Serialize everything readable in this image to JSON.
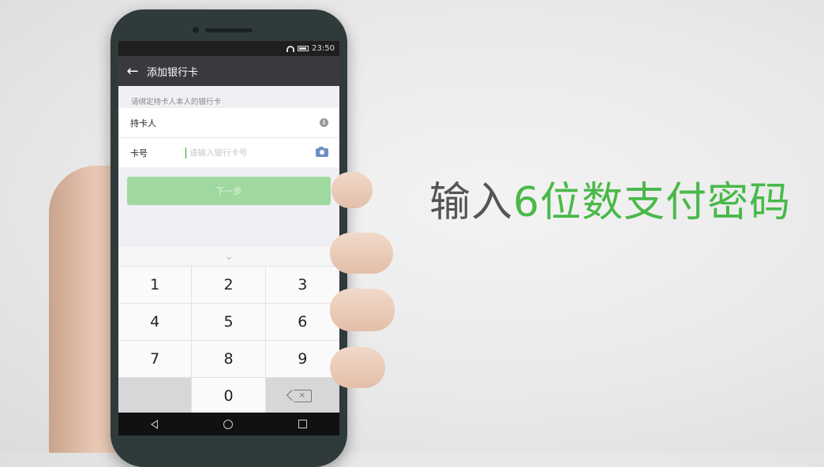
{
  "status_bar": {
    "time": "23:50"
  },
  "header": {
    "back_icon": "arrow-left-icon",
    "title": "添加银行卡"
  },
  "form": {
    "hint": "请绑定持卡人本人的银行卡",
    "cardholder_label": "持卡人",
    "cardholder_info_icon": "info-icon",
    "card_number_label": "卡号",
    "card_number_placeholder": "请输入银行卡号",
    "camera_icon": "camera-icon"
  },
  "next_button": {
    "label": "下一步",
    "color": "#9fd99f"
  },
  "keyboard": {
    "collapse_icon": "chevron-down-icon",
    "keys": [
      "1",
      "2",
      "3",
      "4",
      "5",
      "6",
      "7",
      "8",
      "9",
      "",
      "0",
      "⌫"
    ]
  },
  "caption": {
    "part1": "输入",
    "part2": "6位数支付密码",
    "highlight_color": "#49b94a"
  }
}
